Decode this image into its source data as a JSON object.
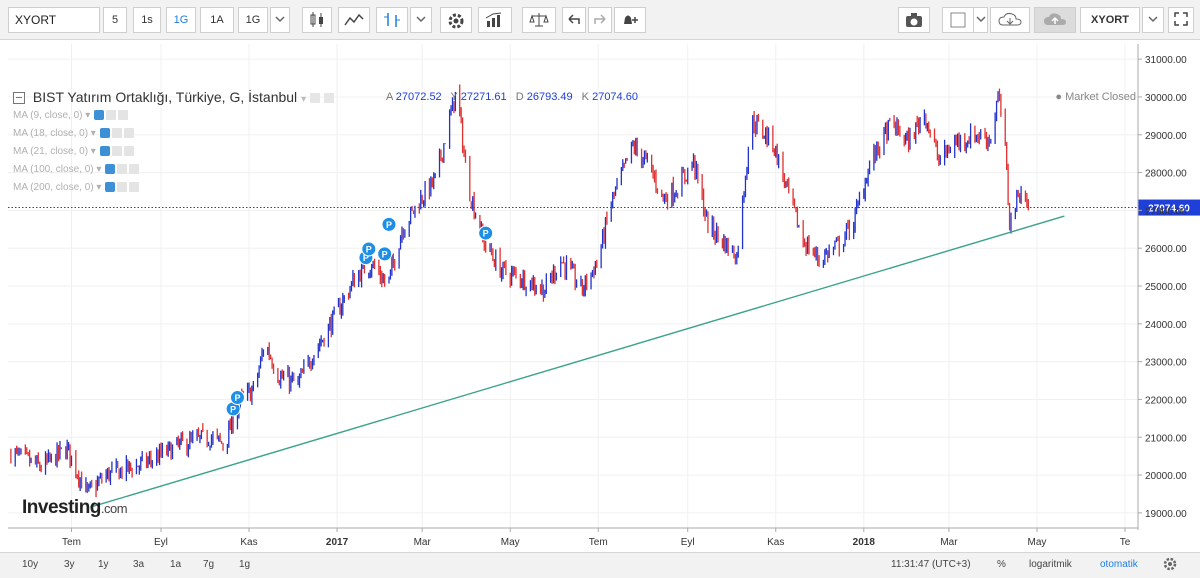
{
  "toolbar": {
    "symbol": "XYORT",
    "intervals": [
      "5",
      "1s",
      "1G",
      "1A",
      "1G"
    ],
    "active_interval": "1G",
    "symbol_right": "XYORT"
  },
  "legend": {
    "title": "BIST Yatırım Ortaklığı, Türkiye, G, İstanbul",
    "ohlc": [
      {
        "key": "A",
        "value": "27072.52"
      },
      {
        "key": "Y",
        "value": "27271.61"
      },
      {
        "key": "D",
        "value": "26793.49"
      },
      {
        "key": "K",
        "value": "27074.60"
      }
    ],
    "indicators": [
      "MA (9, close, 0)",
      "MA (18, close, 0)",
      "MA (21, close, 0)",
      "MA (100, close, 0)",
      "MA (200, close, 0)"
    ],
    "status": "● Market Closed"
  },
  "bottom": {
    "ranges": [
      "10y",
      "3y",
      "1y",
      "3a",
      "1a",
      "7g",
      "1g"
    ],
    "time": "11:31:47 (UTC+3)",
    "percent": "%",
    "log": "logaritmik",
    "auto": "otomatik"
  },
  "watermark": {
    "brand": "Investing",
    "suffix": ".com"
  },
  "colors": {
    "up": "#2233cc",
    "down": "#e03030",
    "trendline": "#3aa38a",
    "price_line": "#1e3fd8",
    "accent": "#1e7fe0"
  },
  "chart_data": {
    "type": "candlestick",
    "y_ticks": [
      19000,
      20000,
      21000,
      22000,
      23000,
      24000,
      25000,
      26000,
      27000,
      28000,
      29000,
      30000,
      31000
    ],
    "y_tick_labels": [
      "19000.00",
      "20000.00",
      "21000.00",
      "22000.00",
      "23000.00",
      "24000.00",
      "25000.00",
      "26000.00",
      "27000.00",
      "28000.00",
      "29000.00",
      "30000.00",
      "31000.00"
    ],
    "ylim": [
      18600,
      31400
    ],
    "x_ticks": [
      {
        "label": "Tem",
        "date": "2016-07-01"
      },
      {
        "label": "Eyl",
        "date": "2016-09-01"
      },
      {
        "label": "Kas",
        "date": "2016-11-01"
      },
      {
        "label": "2017",
        "date": "2017-01-01"
      },
      {
        "label": "Mar",
        "date": "2017-03-01"
      },
      {
        "label": "May",
        "date": "2017-05-01"
      },
      {
        "label": "Tem",
        "date": "2017-07-01"
      },
      {
        "label": "Eyl",
        "date": "2017-09-01"
      },
      {
        "label": "Kas",
        "date": "2017-11-01"
      },
      {
        "label": "2018",
        "date": "2018-01-01"
      },
      {
        "label": "Mar",
        "date": "2018-03-01"
      },
      {
        "label": "May",
        "date": "2018-05-01"
      },
      {
        "label": "Te",
        "date": "2018-07-01"
      }
    ],
    "xlim": [
      "2016-05-18",
      "2018-07-10"
    ],
    "last_price": 27074.6,
    "last_price_label": "27074.60",
    "path": [
      [
        "2016-05-20",
        20600
      ],
      [
        "2016-06-10",
        20200
      ],
      [
        "2016-06-28",
        20700
      ],
      [
        "2016-07-12",
        19500
      ],
      [
        "2016-07-25",
        20000
      ],
      [
        "2016-08-20",
        20300
      ],
      [
        "2016-09-15",
        20800
      ],
      [
        "2016-10-05",
        21000
      ],
      [
        "2016-10-15",
        20800
      ],
      [
        "2016-10-25",
        21900
      ],
      [
        "2016-11-05",
        22300
      ],
      [
        "2016-11-12",
        23500
      ],
      [
        "2016-11-22",
        22600
      ],
      [
        "2016-12-05",
        22400
      ],
      [
        "2016-12-15",
        23200
      ],
      [
        "2016-12-25",
        23800
      ],
      [
        "2017-01-05",
        24600
      ],
      [
        "2017-01-15",
        25300
      ],
      [
        "2017-01-25",
        25600
      ],
      [
        "2017-02-05",
        25000
      ],
      [
        "2017-02-15",
        26500
      ],
      [
        "2017-02-28",
        27300
      ],
      [
        "2017-03-10",
        27800
      ],
      [
        "2017-03-25",
        30200
      ],
      [
        "2017-04-01",
        27800
      ],
      [
        "2017-04-12",
        26200
      ],
      [
        "2017-04-25",
        25400
      ],
      [
        "2017-05-10",
        25200
      ],
      [
        "2017-05-25",
        24900
      ],
      [
        "2017-06-05",
        25700
      ],
      [
        "2017-06-20",
        24900
      ],
      [
        "2017-07-01",
        25700
      ],
      [
        "2017-07-10",
        27200
      ],
      [
        "2017-07-25",
        28700
      ],
      [
        "2017-08-05",
        28200
      ],
      [
        "2017-08-15",
        27300
      ],
      [
        "2017-08-25",
        27600
      ],
      [
        "2017-09-05",
        28300
      ],
      [
        "2017-09-15",
        26600
      ],
      [
        "2017-10-05",
        25800
      ],
      [
        "2017-10-15",
        29400
      ],
      [
        "2017-10-30",
        28800
      ],
      [
        "2017-11-10",
        27400
      ],
      [
        "2017-11-20",
        26200
      ],
      [
        "2017-12-01",
        25700
      ],
      [
        "2017-12-15",
        26100
      ],
      [
        "2017-12-25",
        26700
      ],
      [
        "2018-01-05",
        28200
      ],
      [
        "2018-01-20",
        29300
      ],
      [
        "2018-02-01",
        28800
      ],
      [
        "2018-02-12",
        29600
      ],
      [
        "2018-02-22",
        28300
      ],
      [
        "2018-03-05",
        28800
      ],
      [
        "2018-03-20",
        29000
      ],
      [
        "2018-03-30",
        28900
      ],
      [
        "2018-04-04",
        30000
      ],
      [
        "2018-04-08",
        29200
      ],
      [
        "2018-04-12",
        26700
      ],
      [
        "2018-04-20",
        27600
      ],
      [
        "2018-04-25",
        27074
      ]
    ],
    "trendline": [
      {
        "date": "2016-07-14",
        "value": 19150
      },
      {
        "date": "2018-05-20",
        "value": 26850
      }
    ],
    "markers": [
      {
        "date": "2016-10-21",
        "value": 21750,
        "label": "P"
      },
      {
        "date": "2016-10-24",
        "value": 22050,
        "label": "P"
      },
      {
        "date": "2017-01-21",
        "value": 25750,
        "label": "P"
      },
      {
        "date": "2017-01-23",
        "value": 25980,
        "label": "P"
      },
      {
        "date": "2017-02-03",
        "value": 25850,
        "label": "P"
      },
      {
        "date": "2017-02-06",
        "value": 26630,
        "label": "P"
      },
      {
        "date": "2017-04-14",
        "value": 26400,
        "label": "P"
      }
    ]
  }
}
